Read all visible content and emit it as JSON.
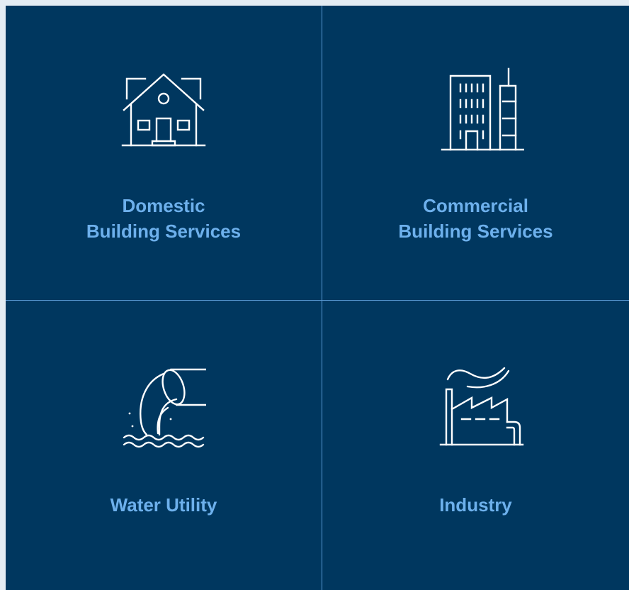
{
  "tiles": [
    {
      "id": "domestic",
      "icon": "house-icon",
      "lines": [
        "Domestic",
        "Building Services"
      ]
    },
    {
      "id": "commercial",
      "icon": "office-building-icon",
      "lines": [
        "Commercial",
        "Building Services"
      ]
    },
    {
      "id": "water",
      "icon": "water-pipe-outflow-icon",
      "lines": [
        "Water Utility"
      ]
    },
    {
      "id": "industry",
      "icon": "factory-icon",
      "lines": [
        "Industry"
      ]
    }
  ],
  "colors": {
    "background": "#00375f",
    "divider": "#5b9bd5",
    "label": "#6db0ec",
    "icon_stroke": "#ffffff",
    "outer_border": "#e4ecf3"
  }
}
